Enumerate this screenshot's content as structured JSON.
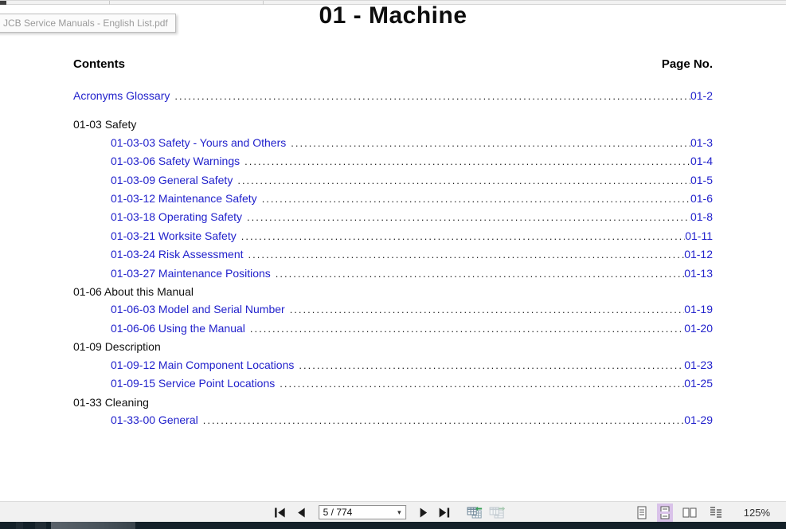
{
  "browser": {
    "tooltip_filename": "JCB Service Manuals - English List.pdf"
  },
  "document": {
    "title": "01 - Machine",
    "contents_label": "Contents",
    "page_no_label": "Page No.",
    "toc": [
      {
        "label": "Acronyms Glossary",
        "page": "01-2",
        "level": 0,
        "link": true,
        "gap_after": true
      },
      {
        "label": "01-03 Safety",
        "page": "",
        "level": 0,
        "link": false
      },
      {
        "label": "01-03-03 Safety - Yours and Others",
        "page": "01-3",
        "level": 1,
        "link": true
      },
      {
        "label": "01-03-06 Safety Warnings",
        "page": "01-4",
        "level": 1,
        "link": true
      },
      {
        "label": "01-03-09 General Safety",
        "page": "01-5",
        "level": 1,
        "link": true
      },
      {
        "label": "01-03-12 Maintenance Safety",
        "page": "01-6",
        "level": 1,
        "link": true
      },
      {
        "label": "01-03-18 Operating Safety",
        "page": "01-8",
        "level": 1,
        "link": true
      },
      {
        "label": "01-03-21 Worksite Safety",
        "page": "01-11",
        "level": 1,
        "link": true
      },
      {
        "label": "01-03-24 Risk Assessment",
        "page": "01-12",
        "level": 1,
        "link": true
      },
      {
        "label": "01-03-27 Maintenance Positions",
        "page": "01-13",
        "level": 1,
        "link": true
      },
      {
        "label": "01-06 About this Manual",
        "page": "",
        "level": 0,
        "link": false
      },
      {
        "label": "01-06-03 Model and Serial Number",
        "page": "01-19",
        "level": 1,
        "link": true
      },
      {
        "label": "01-06-06 Using the Manual",
        "page": "01-20",
        "level": 1,
        "link": true
      },
      {
        "label": "01-09 Description",
        "page": "",
        "level": 0,
        "link": false
      },
      {
        "label": "01-09-12 Main Component Locations",
        "page": "01-23",
        "level": 1,
        "link": true
      },
      {
        "label": "01-09-15 Service Point Locations",
        "page": "01-25",
        "level": 1,
        "link": true
      },
      {
        "label": "01-33 Cleaning",
        "page": "",
        "level": 0,
        "link": false
      },
      {
        "label": "01-33-00 General",
        "page": "01-29",
        "level": 1,
        "link": true
      }
    ]
  },
  "toolbar": {
    "page_display": "5 / 774",
    "zoom_level": "125%",
    "icons": {
      "first_page": "first-page-icon",
      "previous_page": "previous-page-icon",
      "next_page": "next-page-icon",
      "last_page": "last-page-icon",
      "previous_view": "previous-view-icon",
      "next_view": "next-view-icon",
      "layout_single": "single-page-layout-icon",
      "layout_continuous": "continuous-layout-icon",
      "layout_facing": "facing-pages-layout-icon",
      "layout_continuous_facing": "continuous-facing-layout-icon"
    },
    "selected_layout": "continuous"
  },
  "colors": {
    "link_blue": "#2222cc",
    "selected_layout_bg": "#d9c2e9",
    "taskbar_dark": "#132028",
    "toolbar_bg": "#f1f1f1"
  }
}
